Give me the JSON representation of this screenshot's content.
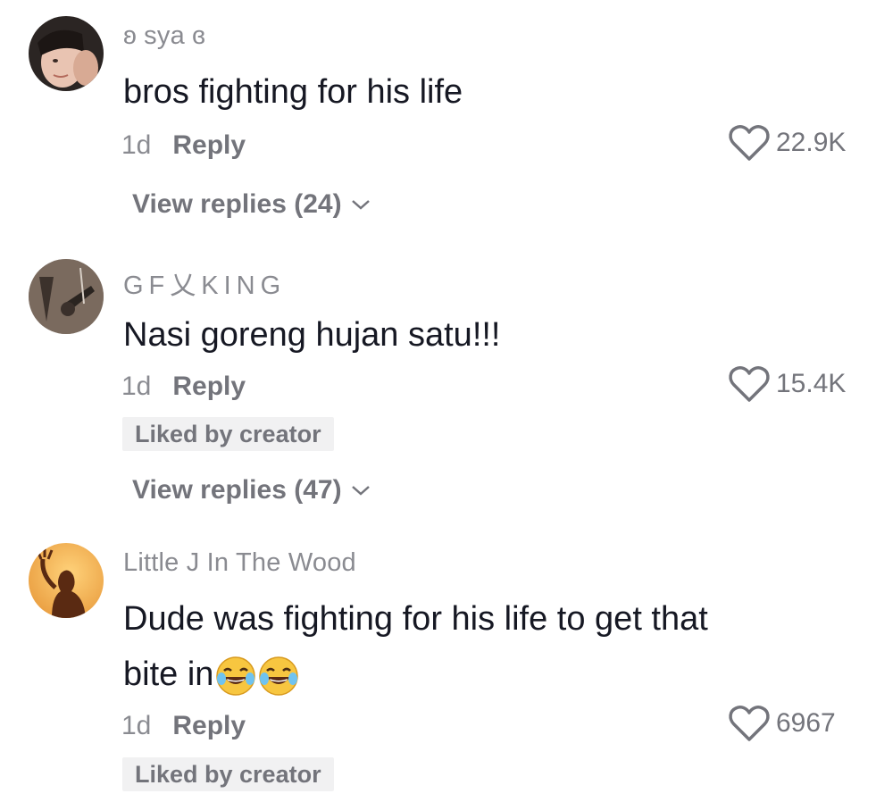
{
  "comments": [
    {
      "username": "ʚ sya ɞ",
      "text": "bros fighting for his life",
      "time": "1d",
      "reply_label": "Reply",
      "likes": "22.9K",
      "view_replies": "View replies (24)"
    },
    {
      "username": "GF乂KING",
      "text": "Nasi goreng hujan satu!!!",
      "time": "1d",
      "reply_label": "Reply",
      "likes": "15.4K",
      "badge": "Liked by creator",
      "view_replies": "View replies (47)"
    },
    {
      "username": "Little J In The Wood",
      "text_line1": "Dude was fighting for his life to get that",
      "text_line2": "bite in",
      "emojis": [
        "laughing-crying-emoji",
        "laughing-crying-emoji"
      ],
      "time": "1d",
      "reply_label": "Reply",
      "likes": "6967",
      "badge": "Liked by creator"
    }
  ],
  "colors": {
    "primary_text": "#161823",
    "secondary_text": "#8a8b91",
    "action_text": "#73747b",
    "badge_bg": "#f1f1f2"
  }
}
